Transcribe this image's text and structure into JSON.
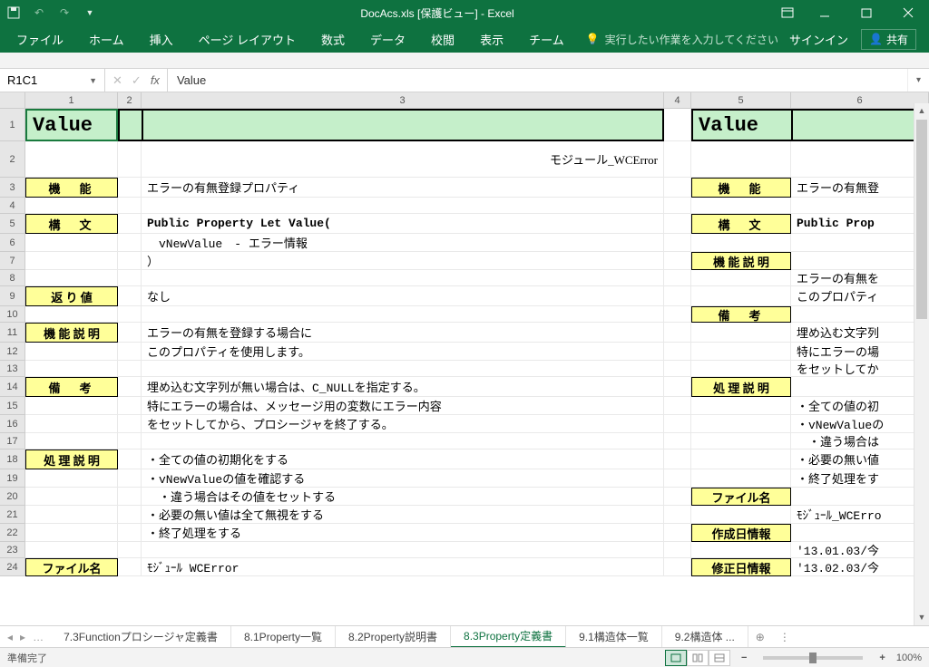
{
  "title": "DocAcs.xls  [保護ビュー] - Excel",
  "qat": {
    "save": "💾",
    "undo": "↶",
    "redo": "↷",
    "custom": "▾"
  },
  "ribbon_tabs": [
    "ファイル",
    "ホーム",
    "挿入",
    "ページ レイアウト",
    "数式",
    "データ",
    "校閲",
    "表示",
    "チーム"
  ],
  "tell_me": "実行したい作業を入力してください",
  "signin": "サインイン",
  "share": "共有",
  "namebox": "R1C1",
  "formula": "Value",
  "col_headers": [
    "1",
    "2",
    "3",
    "4",
    "5",
    "6"
  ],
  "left": {
    "value_header": "Value",
    "module": "モジュール_WCError",
    "labels": {
      "kinou": "機　能",
      "koubun": "構　文",
      "kaerichi": "返 り 値",
      "kinousetsumei": "機 能 説 明",
      "bikou": "備　考",
      "shorisetsumei": "処 理 説 明",
      "filename": "ファイル名"
    },
    "rows": {
      "r3": "エラーの有無登録プロパティ",
      "r5": "Public Property Let Value(",
      "r6": "　vNewValue　- エラー情報",
      "r7": "）",
      "r9": "なし",
      "r11": "エラーの有無を登録する場合に",
      "r12": "このプロパティを使用します。",
      "r14": "埋め込む文字列が無い場合は、C_NULLを指定する。",
      "r15": "特にエラーの場合は、メッセージ用の変数にエラー内容",
      "r16": "をセットしてから、プロシージャを終了する。",
      "r18": "・全ての値の初期化をする",
      "r19": "・vNewValueの値を確認する",
      "r20": "　・違う場合はその値をセットする",
      "r21": "・必要の無い値は全て無視をする",
      "r22": "・終了処理をする",
      "r24": "ﾓｼﾞｭｰﾙ WCError"
    }
  },
  "right": {
    "value_header": "Value",
    "labels": {
      "kinou": "機　能",
      "koubun": "構　文",
      "kinousetsumei": "機 能 説 明",
      "bikou": "備　考",
      "shorisetsumei": "処 理 説 明",
      "filename": "ファイル名",
      "sakuseibi": "作成日情報",
      "shuuseibi": "修正日情報"
    },
    "rows": {
      "r3": "エラーの有無登",
      "r5": "Public Prop",
      "r8": "エラーの有無を",
      "r9": "このプロパティ",
      "r11": "埋め込む文字列",
      "r12": "特にエラーの場",
      "r13": "をセットしてか",
      "r15": "・全ての値の初",
      "r16": "・vNewValueの",
      "r17": "　・違う場合は",
      "r18": "・必要の無い値",
      "r19": "・終了処理をす",
      "r21": "ﾓｼﾞｭｰﾙ_WCErro",
      "r23": "'13.01.03/今",
      "r24": "'13.02.03/今"
    }
  },
  "sheet_tabs": [
    "7.3Functionプロシージャ定義書",
    "8.1Property一覧",
    "8.2Property説明書",
    "8.3Property定義書",
    "9.1構造体一覧",
    "9.2構造体 ..."
  ],
  "active_tab_index": 3,
  "status": "準備完了",
  "zoom": "100%"
}
